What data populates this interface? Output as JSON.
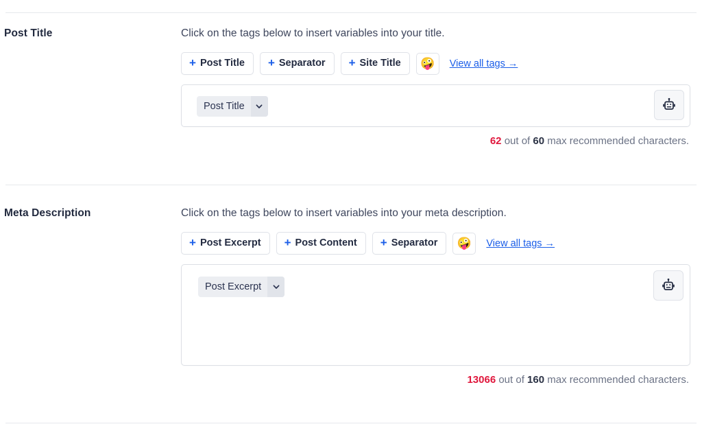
{
  "sections": [
    {
      "id": "post-title",
      "label": "Post Title",
      "helper_text": "Click on the tags below to insert variables into your title.",
      "tag_buttons": [
        {
          "label": "Post Title"
        },
        {
          "label": "Separator"
        },
        {
          "label": "Site Title"
        }
      ],
      "emoji_button": {
        "glyph": "🤪",
        "name": "emoji-picker-icon"
      },
      "view_all_link": "View all tags →",
      "field": {
        "chip_label": "Post Title",
        "ai_button_name": "ai-generate-icon"
      },
      "counter": {
        "current": "62",
        "middle_text": "out of",
        "max": "60",
        "suffix": "max recommended characters."
      }
    },
    {
      "id": "meta-description",
      "label": "Meta Description",
      "helper_text": "Click on the tags below to insert variables into your meta description.",
      "tag_buttons": [
        {
          "label": "Post Excerpt"
        },
        {
          "label": "Post Content"
        },
        {
          "label": "Separator"
        }
      ],
      "emoji_button": {
        "glyph": "🤪",
        "name": "emoji-picker-icon"
      },
      "view_all_link": "View all tags →",
      "field": {
        "chip_label": "Post Excerpt",
        "ai_button_name": "ai-generate-icon"
      },
      "counter": {
        "current": "13066",
        "middle_text": "out of",
        "max": "160",
        "suffix": "max recommended characters."
      }
    }
  ],
  "colors": {
    "accent_blue": "#1b5ee8",
    "error_red": "#e0173c",
    "text_dark": "#232b41",
    "text_muted": "#6b7285",
    "border": "#dfe2e8",
    "chip_bg": "#eceef2",
    "chip_caret_bg": "#e1e4ea",
    "ai_button_bg": "#f6f7f9",
    "divider": "#e6e8ec"
  }
}
